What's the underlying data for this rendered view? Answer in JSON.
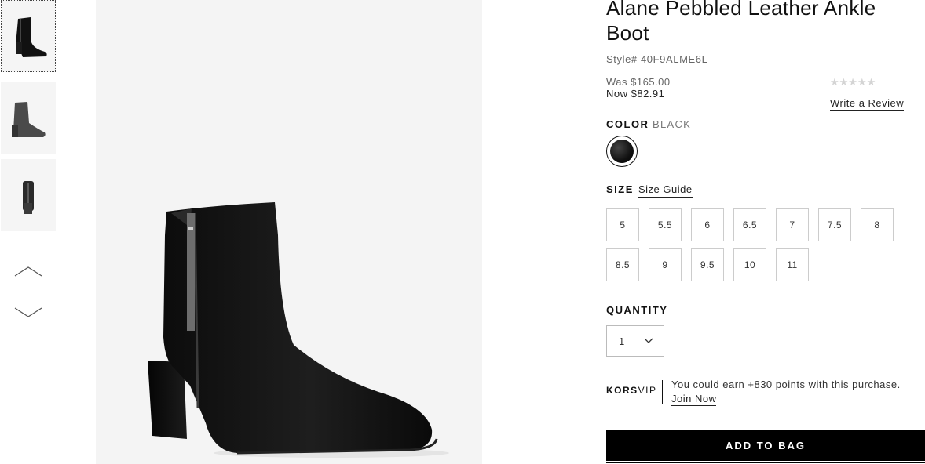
{
  "gallery": {
    "thumbnails": [
      {
        "view": "side"
      },
      {
        "view": "front"
      },
      {
        "view": "back"
      }
    ],
    "nav_up_icon": "chevron-up-icon",
    "nav_down_icon": "chevron-down-icon"
  },
  "product": {
    "title": "Alane Pebbled Leather Ankle Boot",
    "style_number": "Style# 40F9ALME6L",
    "price_was": "Was $165.00",
    "price_now": "Now $82.91",
    "rating_stars": "★★★★★",
    "write_review_label": "Write a Review"
  },
  "color": {
    "label": "COLOR",
    "value": "BLACK",
    "swatch_color": "#111111"
  },
  "size": {
    "label": "SIZE",
    "guide_label": "Size Guide",
    "options": [
      "5",
      "5.5",
      "6",
      "6.5",
      "7",
      "7.5",
      "8",
      "8.5",
      "9",
      "9.5",
      "10",
      "11"
    ]
  },
  "quantity": {
    "label": "QUANTITY",
    "value": "1"
  },
  "vip": {
    "brand_bold": "KORS",
    "brand_rest": "VIP",
    "message": "You could earn +830 points with this purchase.",
    "join_label": "Join Now"
  },
  "actions": {
    "add_to_bag_label": "ADD TO BAG"
  },
  "colors": {
    "primary": "#000000",
    "muted_text": "#666666",
    "border": "#cccccc"
  }
}
